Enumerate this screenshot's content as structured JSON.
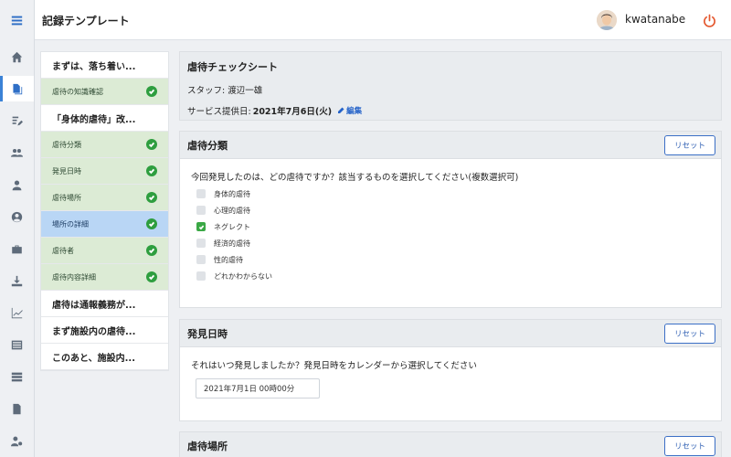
{
  "header": {
    "title": "記録テンプレート",
    "username": "kwatanabe"
  },
  "sidebar": {
    "icons": [
      "menu-icon",
      "home-icon",
      "records-icon",
      "edit-list-icon",
      "group-icon",
      "user-icon",
      "account-circle-icon",
      "briefcase-icon",
      "download-icon",
      "chart-icon",
      "list-icon",
      "table-icon",
      "file-icon",
      "settings-user-icon"
    ]
  },
  "steps": [
    {
      "label": "まずは、落ち着い...",
      "kind": "main",
      "done": false
    },
    {
      "label": "虐待の知識確認",
      "kind": "sub",
      "done": true
    },
    {
      "label": "「身体的虐待」改...",
      "kind": "main",
      "done": false
    },
    {
      "label": "虐待分類",
      "kind": "sub",
      "done": true
    },
    {
      "label": "発見日時",
      "kind": "sub",
      "done": true
    },
    {
      "label": "虐待場所",
      "kind": "sub",
      "done": true
    },
    {
      "label": "場所の詳細",
      "kind": "sub",
      "done": true,
      "current": true
    },
    {
      "label": "虐待者",
      "kind": "sub",
      "done": true
    },
    {
      "label": "虐待内容詳細",
      "kind": "sub",
      "done": true
    },
    {
      "label": "虐待は通報義務が...",
      "kind": "main",
      "done": false
    },
    {
      "label": "まず施設内の虐待...",
      "kind": "main",
      "done": false
    },
    {
      "label": "このあと、施設内...",
      "kind": "main",
      "done": false
    }
  ],
  "info": {
    "title": "虐待チェックシート",
    "staff": "スタッフ: 渡辺一雄",
    "date_label": "サービス提供日:",
    "date_value": "2021年7月6日(火)",
    "edit_label": "編集"
  },
  "classification": {
    "title": "虐待分類",
    "reset_label": "リセット",
    "question": "今回発見したのは、どの虐待ですか？該当するものを選択してください(複数選択可)",
    "options": [
      {
        "label": "身体的虐待",
        "checked": false
      },
      {
        "label": "心理的虐待",
        "checked": false
      },
      {
        "label": "ネグレクト",
        "checked": true
      },
      {
        "label": "経済的虐待",
        "checked": false
      },
      {
        "label": "性的虐待",
        "checked": false
      },
      {
        "label": "どれかわからない",
        "checked": false
      }
    ]
  },
  "discovery": {
    "title": "発見日時",
    "reset_label": "リセット",
    "question": "それはいつ発見しましたか？発見日時をカレンダーから選択してください",
    "value": "2021年7月1日 00時00分"
  },
  "location": {
    "title": "虐待場所",
    "reset_label": "リセット"
  },
  "colors": {
    "accent": "#3b82d6",
    "done_bg": "#dcebd5",
    "current_bg": "#b9d6f5",
    "check": "#2e9e3f",
    "power": "#e4572e"
  }
}
